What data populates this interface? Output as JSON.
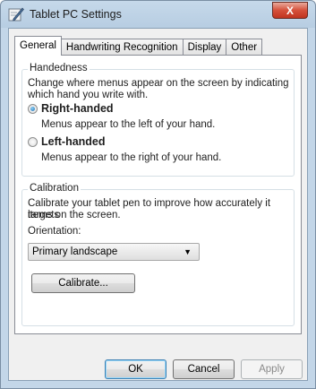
{
  "window": {
    "title": "Tablet PC Settings",
    "close_label": "X"
  },
  "tabs": [
    {
      "label": "General",
      "active": true
    },
    {
      "label": "Handwriting Recognition",
      "active": false
    },
    {
      "label": "Display",
      "active": false
    },
    {
      "label": "Other",
      "active": false
    }
  ],
  "handedness": {
    "title": "Handedness",
    "description_line1": "Change where menus appear on the screen by indicating",
    "description_line2": "which hand you write with.",
    "options": [
      {
        "label": "Right-handed",
        "hint": "Menus appear to the left of your hand.",
        "selected": true
      },
      {
        "label": "Left-handed",
        "hint": "Menus appear to the right of your hand.",
        "selected": false
      }
    ]
  },
  "calibration": {
    "title": "Calibration",
    "description_line1": "Calibrate your tablet pen to improve how accurately it targets",
    "description_line2": "items on the screen.",
    "orientation_label": "Orientation:",
    "orientation_value": "Primary landscape",
    "calibrate_button": "Calibrate..."
  },
  "buttons": {
    "ok": "OK",
    "cancel": "Cancel",
    "apply": "Apply"
  },
  "colors": {
    "accent": "#1b6fb3",
    "close": "#c0341f"
  }
}
